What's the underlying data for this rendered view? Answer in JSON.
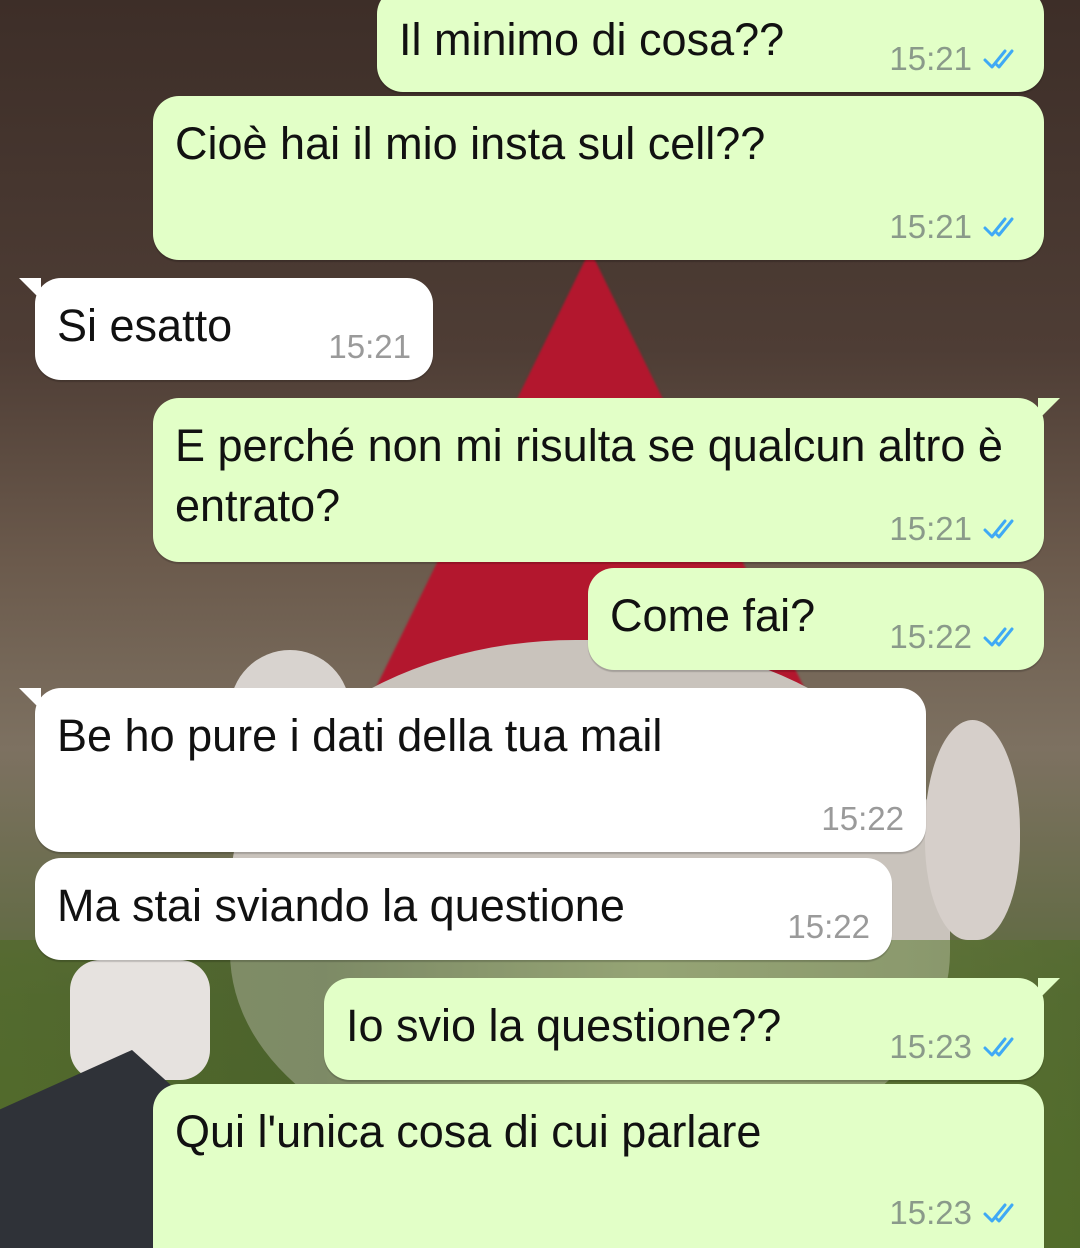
{
  "colors": {
    "outgoing_bubble": "#e2ffc7",
    "incoming_bubble": "#ffffff",
    "read_ticks": "#3fa9f5"
  },
  "icons": {
    "read_receipt": "double-check-icon"
  },
  "messages": [
    {
      "direction": "outgoing",
      "text": "Il minimo di cosa??",
      "time": "15:21",
      "status": "read"
    },
    {
      "direction": "outgoing",
      "text": "Cioè hai il mio insta sul cell??",
      "time": "15:21",
      "status": "read"
    },
    {
      "direction": "incoming",
      "text": "Si esatto",
      "time": "15:21"
    },
    {
      "direction": "outgoing",
      "text": "E perché non mi risulta se qualcun altro è entrato?",
      "time": "15:21",
      "status": "read"
    },
    {
      "direction": "outgoing",
      "text": "Come fai?",
      "time": "15:22",
      "status": "read"
    },
    {
      "direction": "incoming",
      "text": "Be ho pure i dati della tua mail",
      "time": "15:22"
    },
    {
      "direction": "incoming",
      "text": "Ma stai sviando la questione",
      "time": "15:22"
    },
    {
      "direction": "outgoing",
      "text": "Io svio la questione??",
      "time": "15:23",
      "status": "read"
    },
    {
      "direction": "outgoing",
      "text": "Qui l'unica cosa di cui parlare",
      "time": "15:23",
      "status": "read"
    }
  ]
}
